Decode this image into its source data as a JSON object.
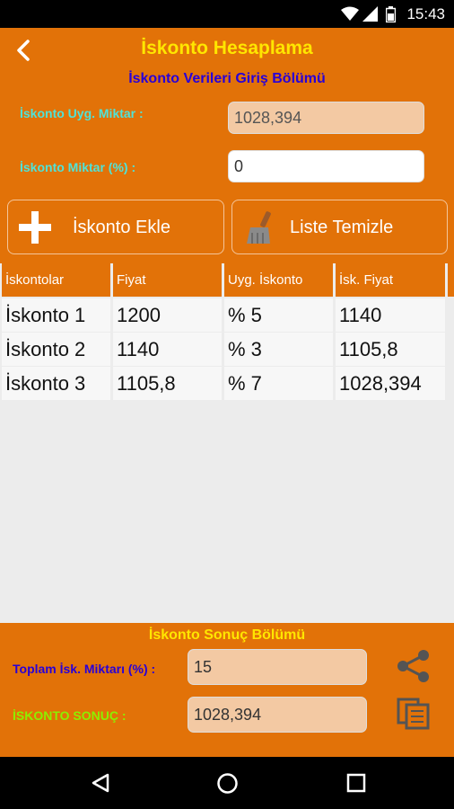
{
  "status_bar": {
    "time": "15:43",
    "icons": [
      "wifi-icon",
      "signal-icon",
      "battery-icon"
    ]
  },
  "header": {
    "title": "İskonto Hesaplama",
    "subtitle": "İskonto Verileri Giriş Bölümü"
  },
  "inputs": {
    "applied_amount_label": "İskonto Uyg. Miktar :",
    "applied_amount_value": "1028,394",
    "discount_percent_label": "İskonto Miktar (%)  :",
    "discount_percent_value": "0"
  },
  "buttons": {
    "add_label": "İskonto Ekle",
    "clear_label": "Liste Temizle"
  },
  "table": {
    "headers": [
      "İskontolar",
      "Fiyat",
      "Uyg. İskonto",
      "İsk. Fiyat"
    ],
    "rows": [
      [
        "İskonto 1",
        "1200",
        "% 5",
        "1140"
      ],
      [
        "İskonto 2",
        "1140",
        "% 3",
        "1105,8"
      ],
      [
        "İskonto 3",
        "1105,8",
        "% 7",
        "1028,394"
      ]
    ]
  },
  "result": {
    "section_title": "İskonto Sonuç Bölümü",
    "total_label": "Toplam İsk. Miktarı (%) :",
    "total_value": "15",
    "result_label": "İSKONTO SONUÇ :",
    "result_value": "1028,394"
  },
  "colors": {
    "primary": "#e27208",
    "title": "#ffe600",
    "subtitle": "#2800d8",
    "label_cyan": "#4fe3d8",
    "result_green": "#8cf000",
    "field_disabled": "#f3c9a3"
  }
}
